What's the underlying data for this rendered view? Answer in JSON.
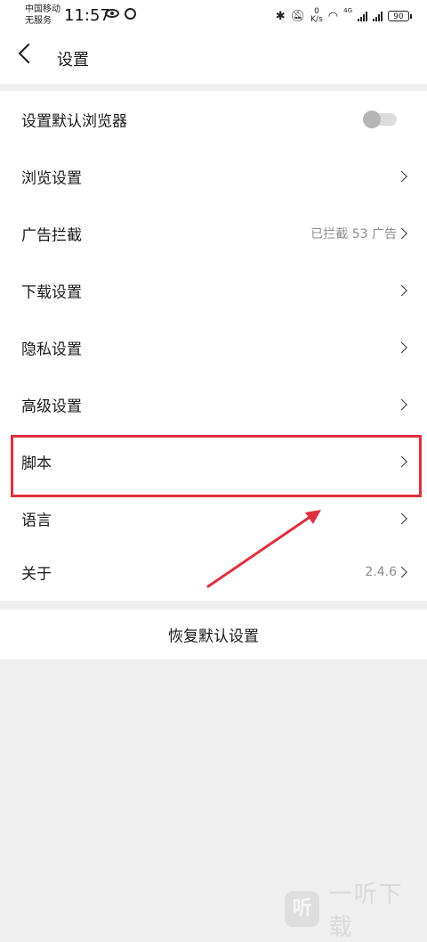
{
  "status_bar": {
    "carrier_line1": "中国移动",
    "carrier_line2": "无服务",
    "time": "11:57",
    "net_speed_value": "0",
    "net_speed_unit": "K/s",
    "network_type": "4G",
    "battery_level": "90"
  },
  "header": {
    "title": "设置"
  },
  "settings": {
    "items": [
      {
        "label": "设置默认浏览器",
        "value": "",
        "control": "toggle",
        "toggle_on": false
      },
      {
        "label": "浏览设置",
        "value": "",
        "control": "chevron"
      },
      {
        "label": "广告拦截",
        "value": "已拦截 53 广告",
        "control": "chevron"
      },
      {
        "label": "下载设置",
        "value": "",
        "control": "chevron"
      },
      {
        "label": "隐私设置",
        "value": "",
        "control": "chevron"
      },
      {
        "label": "高级设置",
        "value": "",
        "control": "chevron"
      },
      {
        "label": "脚本",
        "value": "",
        "control": "chevron"
      },
      {
        "label": "语言",
        "value": "",
        "control": "chevron"
      },
      {
        "label": "关于",
        "value": "2.4.6",
        "control": "chevron"
      }
    ]
  },
  "restore_button": {
    "label": "恢复默认设置"
  },
  "annotation": {
    "color": "#e0303e"
  },
  "watermark": {
    "logo_glyph": "听",
    "text": "一听下载"
  },
  "colors": {
    "background": "#efefef",
    "card": "#ffffff",
    "secondary_text": "#8c8c8c",
    "highlight": "#e0303e"
  }
}
